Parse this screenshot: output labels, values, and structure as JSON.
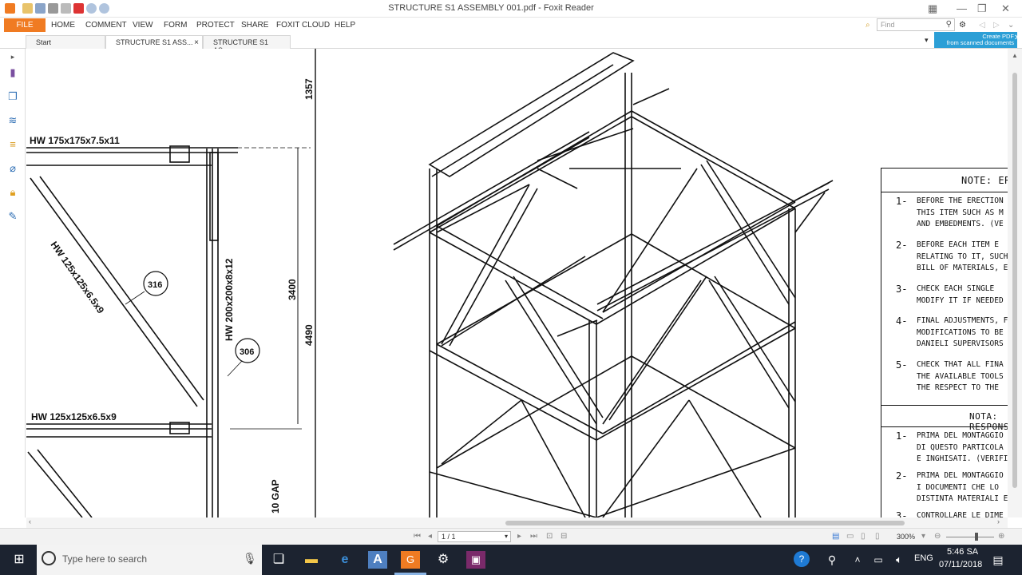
{
  "window": {
    "title": "STRUCTURE S1 ASSEMBLY 001.pdf - Foxit Reader"
  },
  "menu": {
    "file": "FILE",
    "items": [
      "HOME",
      "COMMENT",
      "VIEW",
      "FORM",
      "PROTECT",
      "SHARE",
      "FOXIT CLOUD",
      "HELP"
    ],
    "find_placeholder": "Find"
  },
  "tabs": [
    {
      "label": "Start"
    },
    {
      "label": "STRUCTURE S1 ASS..."
    },
    {
      "label": "STRUCTURE S1 AS..."
    }
  ],
  "promo": {
    "line1": "Create PDF",
    "line2": "from scanned documents"
  },
  "drawing": {
    "beam_top": "HW 175x175x7.5x11",
    "beam_mid": "HW 125x125x6.5x9",
    "brace_diag": "HW 125x125x6.5x9",
    "column": "HW 200x200x8x12",
    "tag1": "316",
    "tag2": "306",
    "dim1": "1357",
    "dim2": "3400",
    "dim3": "4490",
    "gap": "10 GAP",
    "notes": {
      "header": "NOTE: ER",
      "items": [
        {
          "num": "1-",
          "lines": [
            "BEFORE THE ERECTION",
            "THIS ITEM SUCH AS M",
            "AND EMBEDMENTS. (VE"
          ]
        },
        {
          "num": "2-",
          "lines": [
            "BEFORE EACH ITEM E",
            "RELATING TO IT, SUCH",
            "BILL OF MATERIALS, E"
          ]
        },
        {
          "num": "3-",
          "lines": [
            "CHECK EACH SINGLE",
            "MODIFY IT IF NEEDED"
          ]
        },
        {
          "num": "4-",
          "lines": [
            "FINAL ADJUSTMENTS, F",
            "MODIFICATIONS TO BE",
            "DANIELI SUPERVISORS"
          ]
        },
        {
          "num": "5-",
          "lines": [
            "CHECK THAT ALL FINA",
            "THE AVAILABLE TOOLS",
            "THE RESPECT TO THE"
          ]
        }
      ],
      "header2": "NOTA: RESPONS",
      "items2": [
        {
          "num": "1-",
          "lines": [
            "PRIMA DEL MONTAGGIO",
            "DI QUESTO PARTICOLA",
            "E INGHISATI. (VERIFICA"
          ]
        },
        {
          "num": "2-",
          "lines": [
            "PRIMA DEL MONTAGGIO",
            "I DOCUMENTI CHE LO",
            "DISTINTA MATERIALI EC"
          ]
        },
        {
          "num": "3-",
          "lines": [
            "CONTROLLARE LE DIME"
          ]
        }
      ]
    }
  },
  "statusbar": {
    "page": "1 / 1",
    "zoom": "300%"
  },
  "taskbar": {
    "search_placeholder": "Type here to search",
    "lang": "ENG",
    "time": "5:46 SA",
    "date": "07/11/2018"
  }
}
